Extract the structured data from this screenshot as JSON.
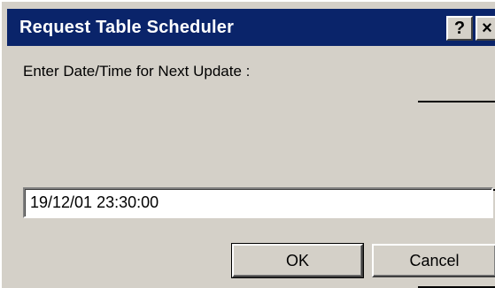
{
  "window": {
    "title": "Request Table Scheduler",
    "help_label": "?",
    "close_label": "×"
  },
  "form": {
    "prompt": "Enter Date/Time for Next Update :",
    "datetime_value": "19/12/01 23:30:00"
  },
  "buttons": {
    "ok_label": "OK",
    "cancel_label": "Cancel"
  },
  "colors": {
    "titlebar": "#0a246a",
    "face": "#d4d0c8"
  }
}
